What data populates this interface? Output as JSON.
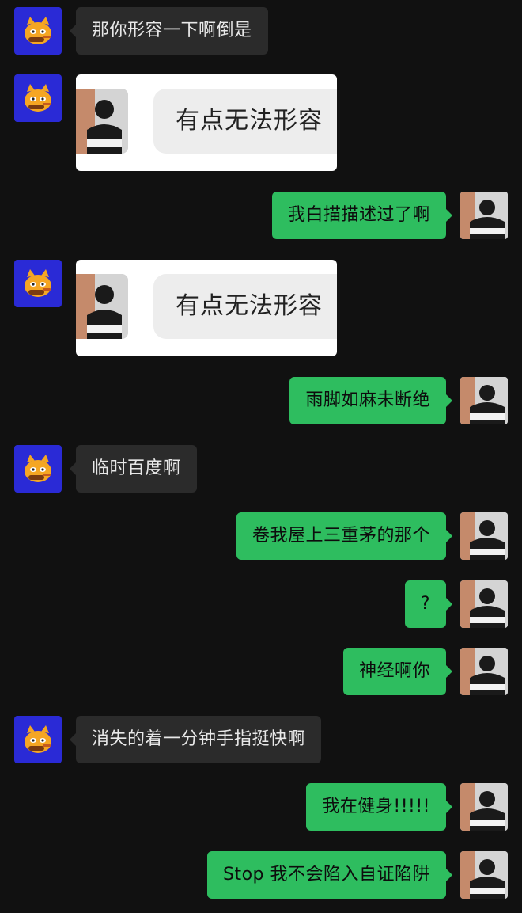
{
  "colors": {
    "background": "#111111",
    "incoming_bubble": "#2b2b2b",
    "outgoing_bubble": "#2ebd5f",
    "bot_avatar_bg": "#2a2ad6"
  },
  "icons": {
    "incoming_avatar": "cartoon-cat-avatar-icon",
    "outgoing_avatar": "person-photo-avatar-icon"
  },
  "messages": [
    {
      "direction": "in",
      "type": "text",
      "text": "那你形容一下啊倒是"
    },
    {
      "direction": "in",
      "type": "image",
      "text": "有点无法形容"
    },
    {
      "direction": "out",
      "type": "text",
      "text": "我白描描述过了啊"
    },
    {
      "direction": "in",
      "type": "image",
      "text": "有点无法形容"
    },
    {
      "direction": "out",
      "type": "text",
      "text": "雨脚如麻未断绝"
    },
    {
      "direction": "in",
      "type": "text",
      "text": "临时百度啊"
    },
    {
      "direction": "out",
      "type": "text",
      "text": "卷我屋上三重茅的那个"
    },
    {
      "direction": "out",
      "type": "text",
      "text": "?"
    },
    {
      "direction": "out",
      "type": "text",
      "text": "神经啊你"
    },
    {
      "direction": "in",
      "type": "text",
      "text": "消失的着一分钟手指挺快啊"
    },
    {
      "direction": "out",
      "type": "text",
      "text": "我在健身!!!!!"
    },
    {
      "direction": "out",
      "type": "text",
      "text": "Stop 我不会陷入自证陷阱"
    }
  ]
}
